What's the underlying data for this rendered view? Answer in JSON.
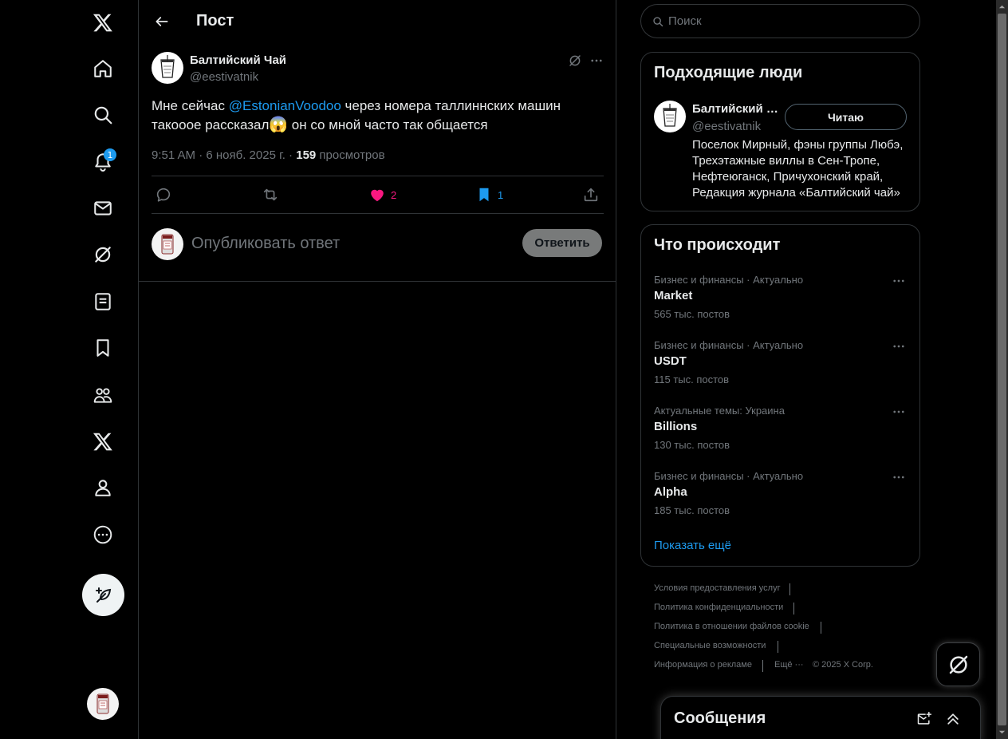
{
  "nav": {
    "notification_badge": "1",
    "icons": [
      "x-logo-icon",
      "home-icon",
      "explore-icon",
      "notifications-icon",
      "messages-icon",
      "grok-icon",
      "lists-icon",
      "bookmarks-icon",
      "communities-icon",
      "premium-icon",
      "profile-icon",
      "more-icon"
    ]
  },
  "header": {
    "title": "Пост"
  },
  "post": {
    "author_name": "Балтийский Чай",
    "author_handle": "@eestivatnik",
    "text_before": "Мне сейчас ",
    "mention": "@EstonianVoodoo",
    "text_after": " через номера таллиннских машин такооое рассказал",
    "text_end": " он со мной часто так общается",
    "emoji": "😱",
    "time": "9:51 AM · 6 нояб. 2025 г. · ",
    "views_count": "159",
    "views_label": " просмотров",
    "likes": "2",
    "bookmarks": "1",
    "like_color": "#f91880",
    "bookmark_color": "#1d9bf0"
  },
  "reply": {
    "placeholder": "Опубликовать ответ",
    "button_label": "Ответить"
  },
  "search": {
    "placeholder": "Поиск"
  },
  "who_to_follow": {
    "title": "Подходящие люди",
    "name": "Балтийский Чай",
    "handle": "@eestivatnik",
    "follow_label": "Читаю",
    "bio": "Поселок Мирный, фэны группы Любэ, Трехэтажные виллы в Сен-Тропе, Нефтеюганск, Причухонский край, Редакция журнала «Балтийский чай»"
  },
  "trends": {
    "title": "Что происходит",
    "items": [
      {
        "category": "Бизнес и финансы · Актуально",
        "name": "Market",
        "count": "565 тыс. постов"
      },
      {
        "category": "Бизнес и финансы · Актуально",
        "name": "USDT",
        "count": "115 тыс. постов"
      },
      {
        "category": "Актуальные темы: Украина",
        "name": "Billions",
        "count": "130 тыс. постов"
      },
      {
        "category": "Бизнес и финансы · Актуально",
        "name": "Alpha",
        "count": "185 тыс. постов"
      }
    ],
    "show_more": "Показать ещё"
  },
  "footer": {
    "terms": "Условия предоставления услуг",
    "privacy": "Политика конфиденциальности",
    "cookies": "Политика в отношении файлов cookie",
    "accessibility": "Специальные возможности",
    "ads": "Информация о рекламе",
    "more": "Ещё ···",
    "copyright": "© 2025 X Corp."
  },
  "messages": {
    "title": "Сообщения"
  },
  "colors": {
    "accent": "#1d9bf0",
    "background": "#000000",
    "border": "#2f3336",
    "muted": "#71767b"
  }
}
